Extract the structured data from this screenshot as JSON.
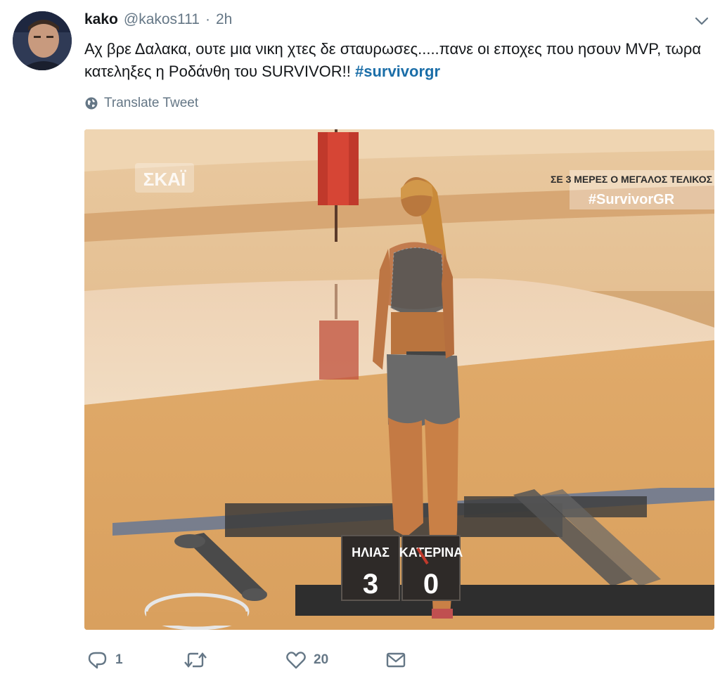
{
  "tweet": {
    "display_name": "kako",
    "handle": "@kakos111",
    "separator": "·",
    "time": "2h",
    "text_part1": "Αχ βρε Δαλακα, ουτε μια νικη χτες δε σταυρωσες.....πανε οι εποχες που ησουν MVP, τωρα κατεληξες η Ροδάνθη του SURVIVOR!! ",
    "hashtag": "#survivorgr",
    "translate_label": "Translate Tweet"
  },
  "media": {
    "channel_logo": "ΣΚΑΪ",
    "banner_line1": "ΣΕ 3 ΜΕΡΕΣ Ο ΜΕΓΑΛΟΣ ΤΕΛΙΚΟΣ",
    "banner_line2": "#SurvivorGR",
    "score_left_name": "ΗΛΙΑΣ",
    "score_left_value": "3",
    "score_right_name": "ΚΑΤΕΡΙΝΑ",
    "score_right_value": "0"
  },
  "actions": {
    "reply_count": "1",
    "retweet_count": "",
    "like_count": "20"
  },
  "icons": {
    "reply": "reply-icon",
    "retweet": "retweet-icon",
    "like": "heart-icon",
    "dm": "envelope-icon",
    "globe": "globe-icon",
    "caret": "chevron-down-icon"
  },
  "colors": {
    "hashtag": "#1b6ea8",
    "muted": "#657786",
    "text": "#14171a"
  }
}
